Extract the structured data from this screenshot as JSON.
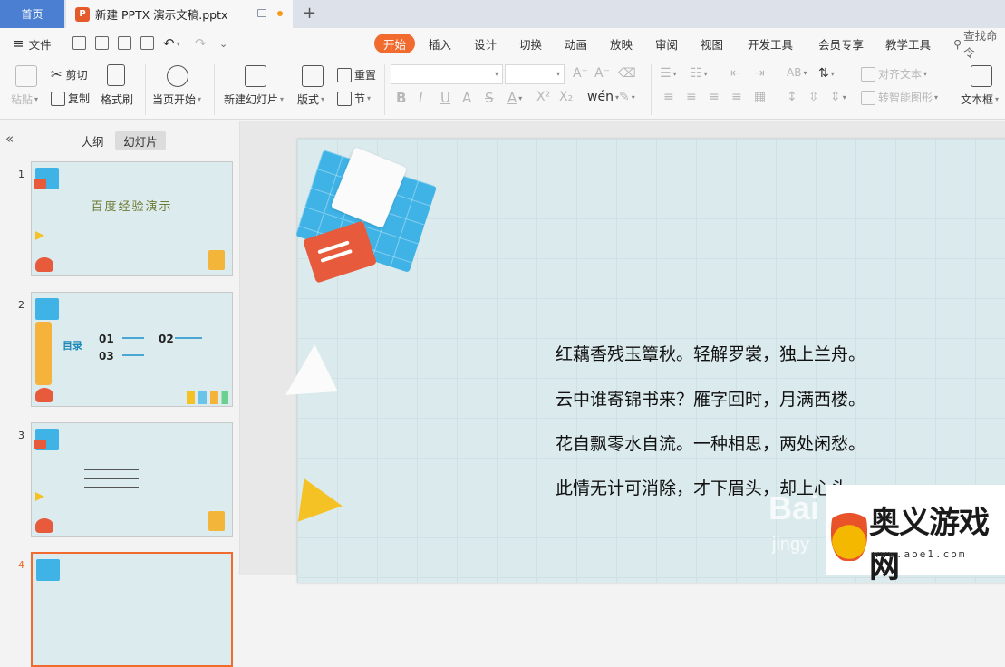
{
  "titlebar": {
    "home_tab": "首页",
    "doc_tab_title": "新建 PPTX 演示文稿.pptx",
    "doc_icon_letter": "P"
  },
  "menu": {
    "file": "文件",
    "tabs": [
      "开始",
      "插入",
      "设计",
      "切换",
      "动画",
      "放映",
      "审阅",
      "视图",
      "开发工具",
      "会员专享",
      "教学工具"
    ],
    "active_tab": "开始",
    "search": "查找命令"
  },
  "ribbon": {
    "paste": "粘贴",
    "cut": "剪切",
    "copy": "复制",
    "format_painter": "格式刷",
    "start_from_current": "当页开始",
    "new_slide": "新建幻灯片",
    "layout": "版式",
    "reset": "重置",
    "section": "节",
    "align_text": "对齐文本",
    "smartart": "转智能图形",
    "textbox": "文本框"
  },
  "left_panel": {
    "tab_outline": "大纲",
    "tab_slides": "幻灯片",
    "collapse_icon": "double-chevron-left-icon",
    "slides": [
      {
        "num": "1",
        "title": "百度经验演示"
      },
      {
        "num": "2",
        "title": "目录",
        "item1": "01",
        "item2": "02",
        "item3": "03"
      },
      {
        "num": "3"
      },
      {
        "num": "4"
      }
    ]
  },
  "slide": {
    "lines": [
      "红藕香残玉簟秋。轻解罗裳，独上兰舟。",
      "云中谁寄锦书来？雁字回时，月满西楼。",
      "花自飘零水自流。一种相思，两处闲愁。",
      "此情无计可消除，才下眉头，却上心头。"
    ]
  },
  "watermark": {
    "brand": "奥义游戏网",
    "url": "www.aoe1.com",
    "baidu_text": "Bai",
    "jingyan_text": "jingy"
  },
  "colors": {
    "accent": "#f06b2d",
    "home_tab": "#4a7fd2",
    "slide_bg": "#dbeaed"
  }
}
